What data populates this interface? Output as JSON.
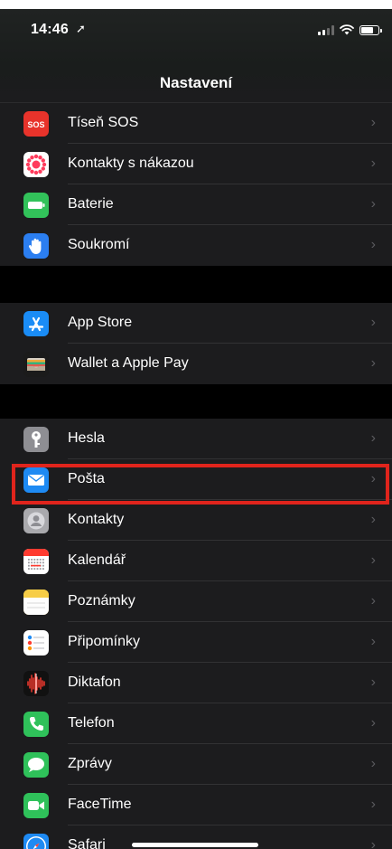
{
  "status_bar": {
    "time": "14:46",
    "location_glyph": "➚"
  },
  "nav": {
    "title": "Nastavení"
  },
  "groups": [
    [
      {
        "label": "Tíseň SOS",
        "icon": "sos-icon",
        "color": "#e8332b"
      },
      {
        "label": "Kontakty s nákazou",
        "icon": "exposure-icon",
        "color": "#ffffff"
      },
      {
        "label": "Baterie",
        "icon": "battery-icon",
        "color": "#32c25a"
      },
      {
        "label": "Soukromí",
        "icon": "hand-icon",
        "color": "#2b7ef0"
      }
    ],
    [
      {
        "label": "App Store",
        "icon": "app-store-icon",
        "color": "#1a8cf6"
      },
      {
        "label": "Wallet a Apple Pay",
        "icon": "wallet-icon",
        "color": "#1b1b1b"
      }
    ],
    [
      {
        "label": "Hesla",
        "icon": "key-icon",
        "color": "#8e8e93"
      },
      {
        "label": "Pošta",
        "icon": "mail-icon",
        "color": "#1e8af3"
      },
      {
        "label": "Kontakty",
        "icon": "contacts-icon",
        "color": "#a9a9ad"
      },
      {
        "label": "Kalendář",
        "icon": "calendar-icon",
        "color": "#ffffff"
      },
      {
        "label": "Poznámky",
        "icon": "notes-icon",
        "color": "#f7cd46"
      },
      {
        "label": "Připomínky",
        "icon": "reminders-icon",
        "color": "#ffffff"
      },
      {
        "label": "Diktafon",
        "icon": "voice-memos-icon",
        "color": "#111111"
      },
      {
        "label": "Telefon",
        "icon": "phone-icon",
        "color": "#2fc15a"
      },
      {
        "label": "Zprávy",
        "icon": "messages-icon",
        "color": "#2fc15a"
      },
      {
        "label": "FaceTime",
        "icon": "facetime-icon",
        "color": "#2fc15a"
      },
      {
        "label": "Safari",
        "icon": "safari-icon",
        "color": "#1e8af3"
      }
    ]
  ],
  "chevron": "›",
  "highlight_color": "#e0241c"
}
